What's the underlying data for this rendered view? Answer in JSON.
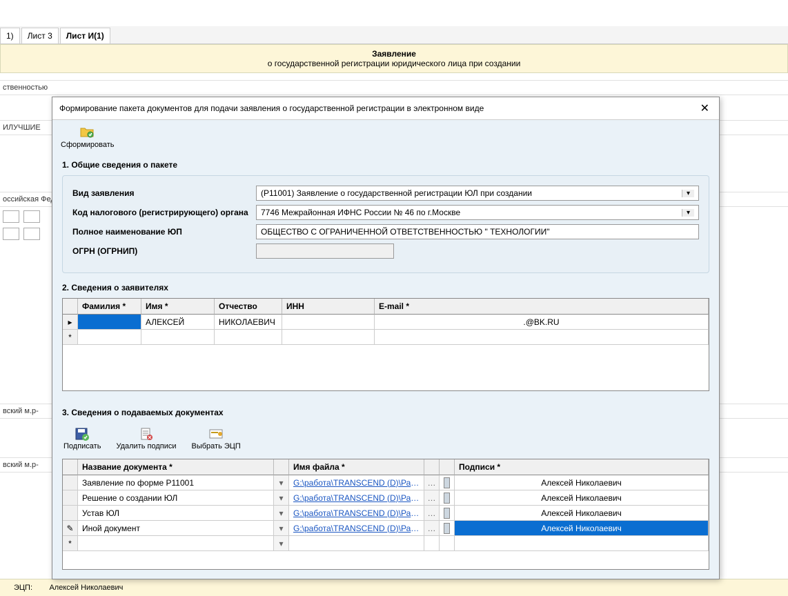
{
  "tabs": {
    "t1": "1)",
    "t2": "Лист 3",
    "t3": "Лист И(1)"
  },
  "header": {
    "line1": "Заявление",
    "line2": "о государственной регистрации юридического лица при создании"
  },
  "bg": {
    "row1": "ственностью",
    "row2": "ИЛУЧШИЕ",
    "row3": "оссийская Фед",
    "row4a": "вский м.р-",
    "row4b": "вский м.р-",
    "ecp_label": "ЭЦП:",
    "ecp_value": "Алексей Николаевич"
  },
  "dialog": {
    "title": "Формирование пакета документов для подачи заявления о государственной регистрации в электронном виде",
    "generate": "Сформировать"
  },
  "section1": {
    "title": "1. Общие сведения о пакете",
    "label_vid": "Вид заявления",
    "value_vid": "(Р11001) Заявление о государственной регистрации ЮЛ при создании",
    "label_kod": "Код налогового (регистрирующего) органа",
    "value_kod": "7746 Межрайонная ИФНС России № 46 по г.Москве",
    "label_name": "Полное наименование ЮП",
    "value_name": "ОБЩЕСТВО С ОГРАНИЧЕННОЙ ОТВЕТСТВЕННОСТЬЮ \"                                     ТЕХНОЛОГИИ\"",
    "label_ogrn": "ОГРН (ОГРНИП)",
    "value_ogrn": ""
  },
  "section2": {
    "title": "2. Сведения о заявителях",
    "col_fam": "Фамилия *",
    "col_name": "Имя *",
    "col_otch": "Отчество",
    "col_inn": "ИНН",
    "col_email": "E-mail *",
    "rows": [
      {
        "fam": "",
        "name": "АЛЕКСЕЙ",
        "otch": "НИКОЛАЕВИЧ",
        "inn": "",
        "email": ".@BK.RU"
      }
    ]
  },
  "section3": {
    "title": "3. Сведения о подаваемых документах",
    "btn_sign": "Подписать",
    "btn_unsign": "Удалить подписи",
    "btn_pick": "Выбрать ЭЦП",
    "col_doc": "Название документа *",
    "col_file": "Имя файла *",
    "col_sig": "Подписи *",
    "rows": [
      {
        "doc": "Заявление по форме Р11001",
        "file": "G:\\работа\\TRANSCEND (D)\\Работа\\П...",
        "sig": "Алексей Николаевич"
      },
      {
        "doc": "Решение о создании ЮЛ",
        "file": "G:\\работа\\TRANSCEND (D)\\Работа\\П...",
        "sig": "Алексей Николаевич"
      },
      {
        "doc": "Устав ЮЛ",
        "file": "G:\\работа\\TRANSCEND (D)\\Работа\\П...",
        "sig": "Алексей Николаевич"
      },
      {
        "doc": "Иной документ",
        "file": "G:\\работа\\TRANSCEND (D)\\Работа\\П...",
        "sig": "Алексей Николаевич"
      }
    ]
  }
}
